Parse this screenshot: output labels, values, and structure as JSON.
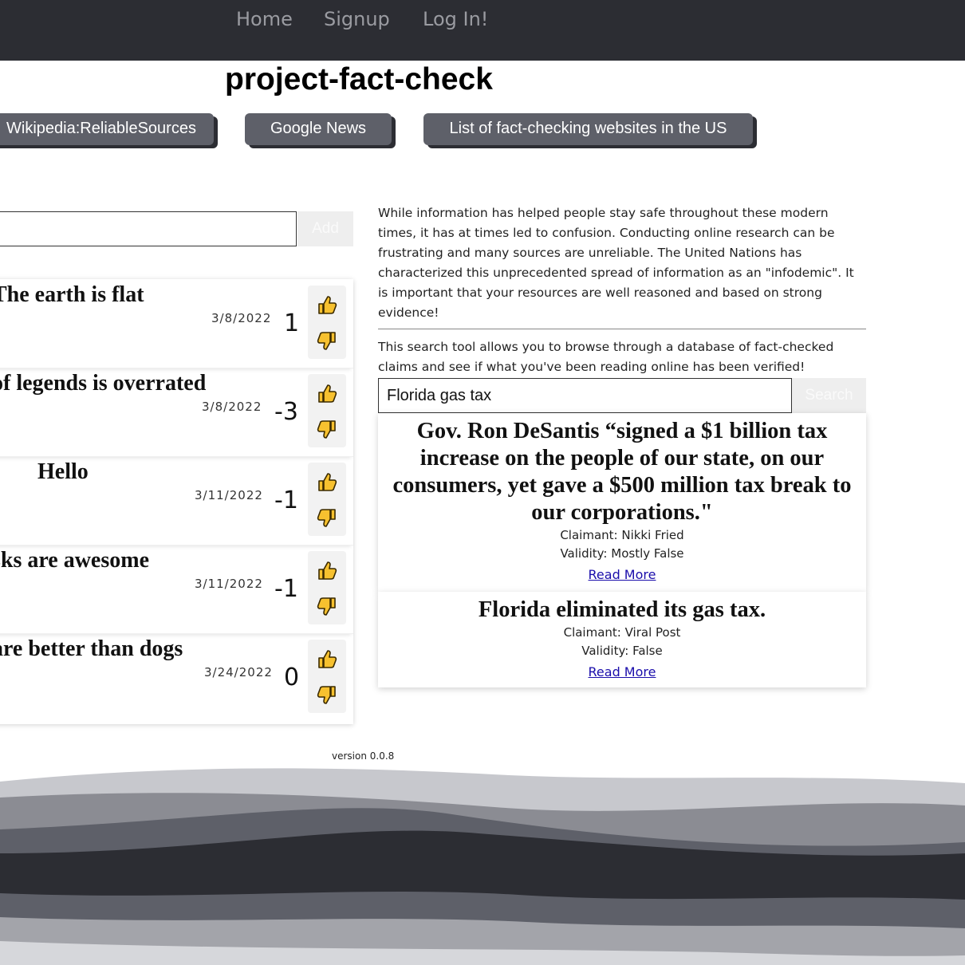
{
  "nav": {
    "home": "Home",
    "signup": "Signup",
    "login": "Log In!"
  },
  "page_title": "project-fact-check",
  "links": {
    "wikipedia": "Wikipedia:ReliableSources",
    "google_news": "Google News",
    "fact_check_list": "List of fact-checking websites in the US"
  },
  "claim_form": {
    "input_value": "",
    "add_label": "Add"
  },
  "claims": [
    {
      "text": "The earth is flat",
      "date": "3/8/2022",
      "score": "1"
    },
    {
      "text": "of legends is overrated",
      "date": "3/8/2022",
      "score": "-3"
    },
    {
      "text": "Hello",
      "date": "3/11/2022",
      "score": "-1"
    },
    {
      "text": "sks are awesome",
      "date": "3/11/2022",
      "score": "-1"
    },
    {
      "text": "are better than dogs",
      "date": "3/24/2022",
      "score": "0"
    }
  ],
  "info": {
    "paragraph": "While information has helped people stay safe throughout these modern times, it has at times led to confusion. Conducting online research can be frustrating and many sources are unreliable. The United Nations has characterized this unprecedented spread of information as an \"infodemic\". It is important that your resources are well reasoned and based on strong evidence!",
    "search_description": "This search tool allows you to browse through a database of fact-checked claims and see if what you've been reading online has been verified!"
  },
  "search": {
    "query": "Florida gas tax",
    "button_label": "Search"
  },
  "results": [
    {
      "claim": "Gov. Ron DeSantis “signed a $1 billion tax increase on the people of our state, on our consumers, yet gave a $500 million tax break to our corporations.\"",
      "claimant": "Claimant: Nikki Fried",
      "validity": "Validity: Mostly False",
      "read_more": "Read More"
    },
    {
      "claim": "Florida eliminated its gas tax.",
      "claimant": "Claimant: Viral Post",
      "validity": "Validity: False",
      "read_more": "Read More"
    }
  ],
  "version": "version 0.0.8",
  "colors": {
    "navbar": "#2c2d33",
    "button": "#5e6069",
    "thumb": "#f7c12f"
  }
}
